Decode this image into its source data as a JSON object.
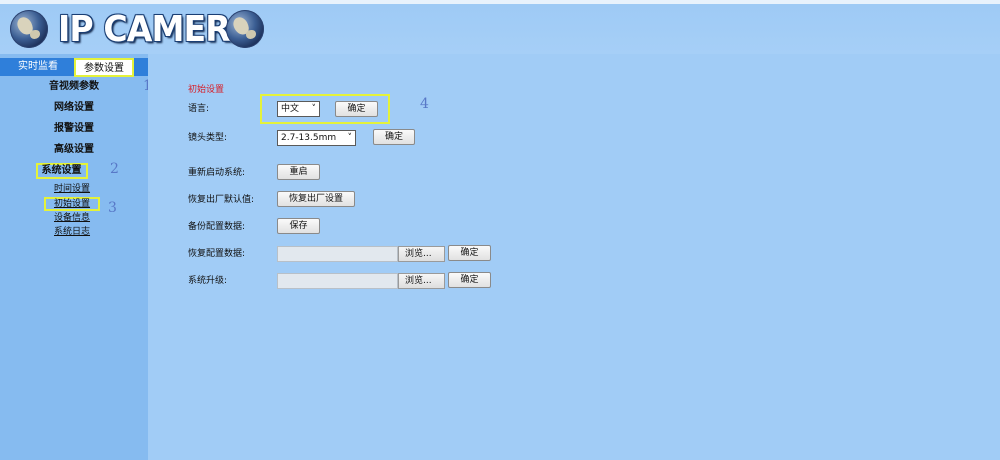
{
  "header": {
    "logo_text": "IP CAMERA"
  },
  "nav": {
    "tabs": [
      {
        "label": "实时监看"
      },
      {
        "label": "参数设置"
      }
    ]
  },
  "sidebar": {
    "menu": [
      {
        "label": "音视频参数"
      },
      {
        "label": "网络设置"
      },
      {
        "label": "报警设置"
      },
      {
        "label": "高级设置"
      },
      {
        "label": "系统设置"
      }
    ],
    "submenu": [
      {
        "label": "时间设置"
      },
      {
        "label": "初始设置"
      },
      {
        "label": "设备信息"
      },
      {
        "label": "系统日志"
      }
    ]
  },
  "annotations": [
    "1",
    "2",
    "3",
    "4"
  ],
  "content": {
    "section_title": "初始设置",
    "language": {
      "label": "语言:",
      "selected": "中文",
      "confirm": "确定"
    },
    "lens": {
      "label": "镜头类型:",
      "selected": "2.7-13.5mm",
      "confirm": "确定"
    },
    "reboot": {
      "label": "重新启动系统:",
      "button": "重启"
    },
    "factory": {
      "label": "恢复出厂默认值:",
      "button": "恢复出厂设置"
    },
    "backup": {
      "label": "备份配置数据:",
      "button": "保存"
    },
    "restore": {
      "label": "恢复配置数据:",
      "browse": "浏览...",
      "confirm": "确定"
    },
    "upgrade": {
      "label": "系统升级:",
      "browse": "浏览...",
      "confirm": "确定"
    }
  },
  "colors": {
    "accent_blue": "#2f7fda",
    "highlight_yellow": "#e4f23a",
    "title_red": "#d6202a",
    "annotation_blue": "#5878c7"
  }
}
